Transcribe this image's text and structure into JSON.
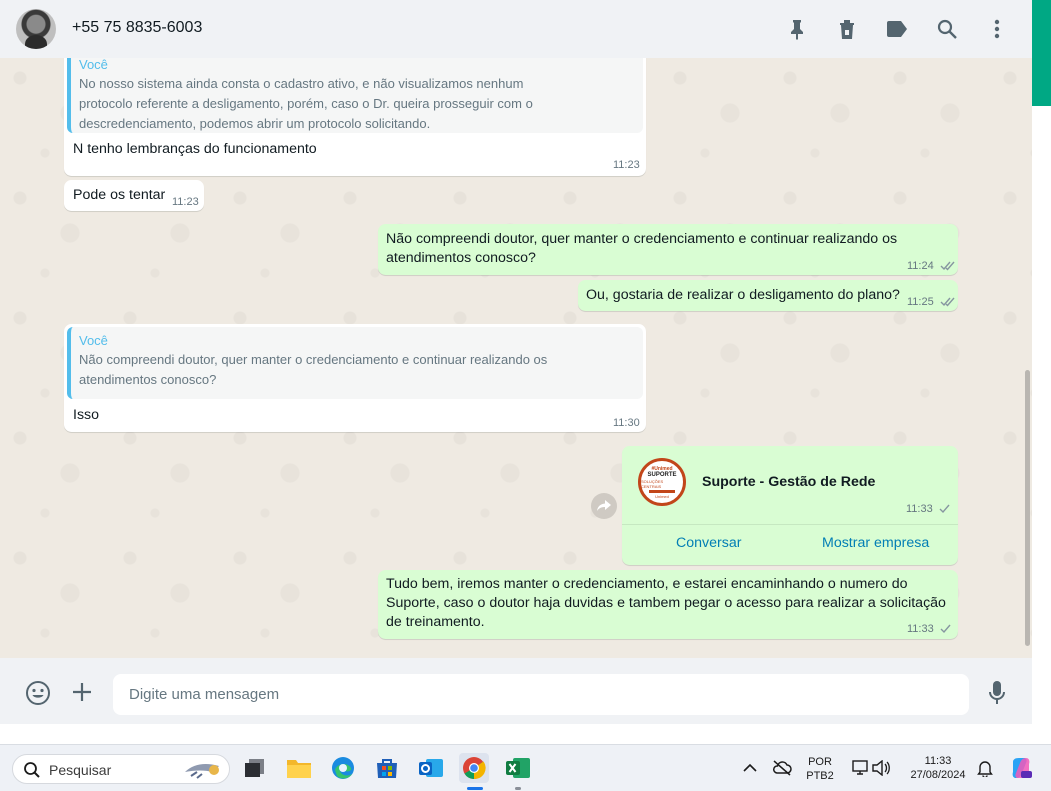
{
  "header": {
    "contact_name": "+55 75 8835-6003",
    "icons": [
      "pin-icon",
      "trash-icon",
      "label-icon",
      "search-icon",
      "menu-icon"
    ]
  },
  "messages": [
    {
      "direction": "incoming",
      "quote_author": "Você",
      "quote_lines": [
        "No nosso sistema ainda consta o cadastro ativo, e não visualizamos nenhum",
        "protocolo referente a desligamento, porém, caso o Dr. queira prosseguir com o",
        "descredenciamento, podemos abrir um protocolo solicitando."
      ],
      "text": "N tenho lembranças do funcionamento",
      "time": "11:23"
    },
    {
      "direction": "incoming",
      "text": "Pode os tentar",
      "time": "11:23"
    },
    {
      "direction": "outgoing",
      "lines": [
        "Não compreendi doutor, quer manter o credenciamento e continuar realizando os",
        "atendimentos conosco?"
      ],
      "time": "11:24",
      "status": "read"
    },
    {
      "direction": "outgoing",
      "text": "Ou, gostaria de realizar o desligamento do plano?",
      "time": "11:25",
      "status": "read"
    },
    {
      "direction": "incoming",
      "quote_author": "Você",
      "quote_lines": [
        "Não compreendi doutor, quer manter o credenciamento e continuar realizando os",
        "atendimentos conosco?"
      ],
      "text": "Isso",
      "time": "11:30"
    },
    {
      "direction": "outgoing",
      "type": "contact-card",
      "card_title": "Suporte - Gestão de Rede",
      "logo_lines": [
        "#Unimed",
        "SUPORTE",
        "SOLUÇÕES CENTRAIS",
        "Unimed"
      ],
      "time": "11:33",
      "status": "sent",
      "actions": [
        "Conversar",
        "Mostrar empresa"
      ]
    },
    {
      "direction": "outgoing",
      "lines": [
        "Tudo bem, iremos manter o credenciamento, e estarei encaminhando o numero do",
        "Suporte, caso o doutor haja duvidas e tambem pegar o acesso para realizar a solicitação",
        "de treinamento."
      ],
      "time": "11:33",
      "status": "sent"
    }
  ],
  "composer": {
    "placeholder": "Digite uma mensagem"
  },
  "taskbar": {
    "search_placeholder": "Pesquisar",
    "language_line1": "POR",
    "language_line2": "PTB2",
    "time": "11:33",
    "date": "27/08/2024",
    "pinned_apps": [
      "file-explorer-icon",
      "edge-icon",
      "store-icon",
      "outlook-icon",
      "chrome-icon",
      "excel-icon"
    ]
  },
  "colors": {
    "accent": "#00a884",
    "outgoing_bubble": "#d9fdd3",
    "incoming_bubble": "#ffffff",
    "quote_bar": "#53bdeb",
    "read_tick": "#53bdeb",
    "link": "#027eb5"
  }
}
